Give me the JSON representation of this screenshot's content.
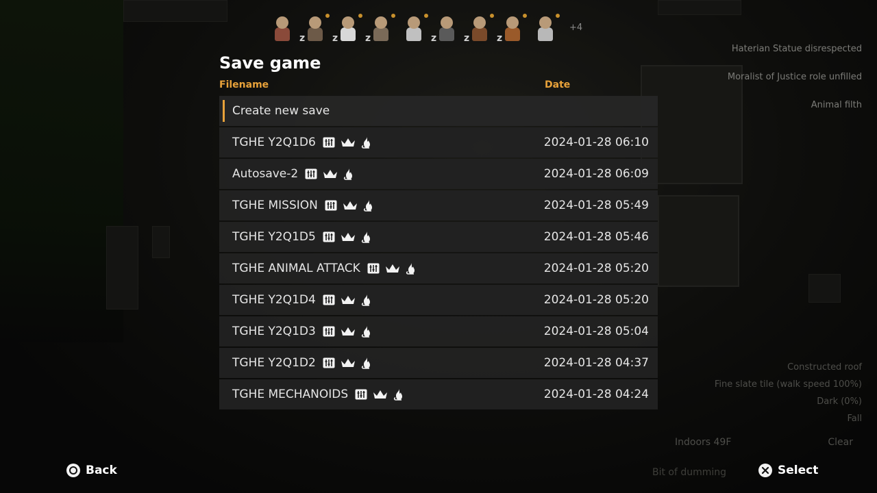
{
  "colonist_bar": {
    "colonists": [
      {
        "sleeping": false,
        "alert_dot": false
      },
      {
        "sleeping": true,
        "alert_dot": true
      },
      {
        "sleeping": true,
        "alert_dot": true
      },
      {
        "sleeping": true,
        "alert_dot": true
      },
      {
        "sleeping": false,
        "alert_dot": true
      },
      {
        "sleeping": true,
        "alert_dot": false
      },
      {
        "sleeping": true,
        "alert_dot": true
      },
      {
        "sleeping": true,
        "alert_dot": true
      },
      {
        "sleeping": false,
        "alert_dot": true
      }
    ],
    "sleep_glyph": "z",
    "more_label": "+4"
  },
  "alerts": [
    "Haterian Statue disrespected",
    "Moralist of Justice role unfilled",
    "Animal filth"
  ],
  "inspect": [
    "Constructed roof",
    "Fine slate tile (walk speed 100%)",
    "Dark (0%)",
    "Fall"
  ],
  "weather": {
    "temperature": "Indoors 49F",
    "condition": "Clear"
  },
  "time_speed_label": "Bit of dumming",
  "dialog": {
    "title": "Save game",
    "filename_header": "Filename",
    "date_header": "Date",
    "create_new_label": "Create new save",
    "saves": [
      {
        "name": "TGHE Y2Q1D6",
        "date": "2024-01-28 06:10"
      },
      {
        "name": "Autosave-2",
        "date": "2024-01-28 06:09"
      },
      {
        "name": "TGHE MISSION",
        "date": "2024-01-28 05:49"
      },
      {
        "name": "TGHE Y2Q1D5",
        "date": "2024-01-28 05:46"
      },
      {
        "name": "TGHE ANIMAL ATTACK",
        "date": "2024-01-28 05:20"
      },
      {
        "name": "TGHE Y2Q1D4",
        "date": "2024-01-28 05:20"
      },
      {
        "name": "TGHE Y2Q1D3",
        "date": "2024-01-28 05:04"
      },
      {
        "name": "TGHE Y2Q1D2",
        "date": "2024-01-28 04:37"
      },
      {
        "name": "TGHE MECHANOIDS",
        "date": "2024-01-28 04:24"
      }
    ],
    "save_icons": [
      "storyteller-settings-icon",
      "royalty-crown-icon",
      "ideology-flame-icon"
    ]
  },
  "footer": {
    "back_label": "Back",
    "back_glyph": "circle-button-icon",
    "select_label": "Select",
    "select_glyph": "cross-button-icon"
  },
  "colors": {
    "accent": "#e8a23a",
    "row_bg": "#222222",
    "text": "#e6e6e6"
  }
}
